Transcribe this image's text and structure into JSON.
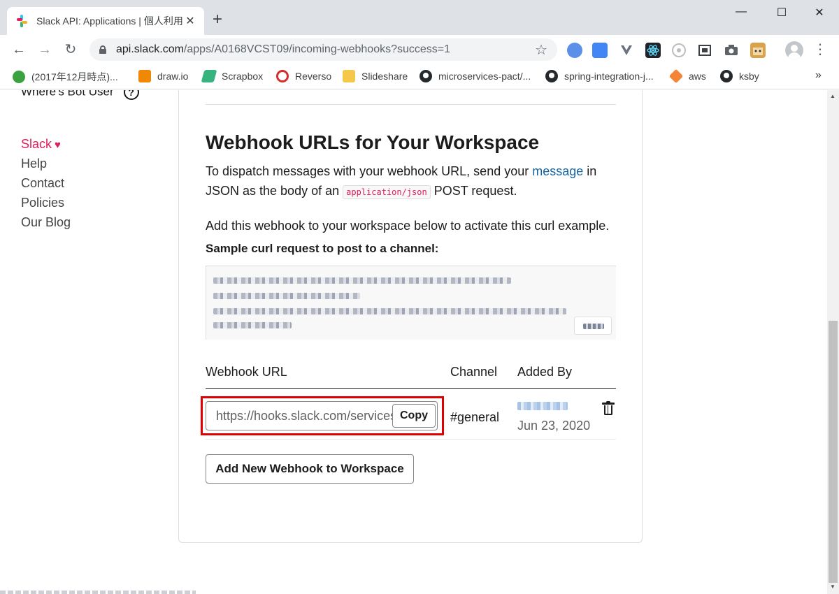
{
  "browser": {
    "tab_title": "Slack API: Applications | 個人利用",
    "tab_close": "✕",
    "new_tab": "+",
    "window_controls": {
      "minimize": "—",
      "maximize": "☐",
      "close": "✕"
    },
    "url_host": "api.slack.com",
    "url_path": "/apps/A0168VCST09/incoming-webhooks?success=1",
    "nav": {
      "back": "←",
      "forward": "→",
      "reload": "↻"
    },
    "star": "☆",
    "menu": "⋮",
    "extensions": [
      {
        "icon": "enhancer-icon",
        "color": "#5b8fe8"
      },
      {
        "icon": "google-translate-icon",
        "color": "#4285f4"
      },
      {
        "icon": "vuejs-devtools-icon",
        "color": "#6b7280"
      },
      {
        "icon": "react-devtools-icon",
        "color": "#20232a"
      },
      {
        "icon": "lighthouse-icon",
        "color": "#d6d6d6"
      },
      {
        "icon": "screen-capture-icon",
        "color": "#3c4043"
      },
      {
        "icon": "camera-icon",
        "color": "#5f6368"
      },
      {
        "icon": "tampermonkey-icon",
        "color": "#d9a34b"
      }
    ]
  },
  "bookmarks": {
    "items": [
      {
        "label": "(2017年12月時点)...",
        "icon": "green-leaf-icon",
        "color": "#3aa340"
      },
      {
        "label": "draw.io",
        "icon": "drawio-icon",
        "color": "#f08705"
      },
      {
        "label": "Scrapbox",
        "icon": "scrapbox-icon",
        "color": "#36b37e"
      },
      {
        "label": "Reverso",
        "icon": "reverso-icon",
        "color": "#1f4fa3"
      },
      {
        "label": "Slideshare",
        "icon": "folder-icon",
        "color": "#f5c84b"
      },
      {
        "label": "microservices-pact/...",
        "icon": "github-icon",
        "color": "#24292e"
      },
      {
        "label": "spring-integration-j...",
        "icon": "github-icon",
        "color": "#24292e"
      },
      {
        "label": "aws",
        "icon": "aws-cube-icon",
        "color": "#f58536"
      },
      {
        "label": "ksby",
        "icon": "github-icon",
        "color": "#24292e"
      }
    ],
    "more": "»"
  },
  "sidebar": {
    "cut_item": "Where's Bot User",
    "help_glyph": "?",
    "slack_label": "Slack",
    "heart": "♥",
    "links": [
      "Help",
      "Contact",
      "Policies",
      "Our Blog"
    ]
  },
  "main": {
    "title": "Webhook URLs for Your Workspace",
    "para1_before_link": "To dispatch messages with your webhook URL, send your ",
    "para1_link": "message",
    "para1_after_link": " in JSON as the body of an ",
    "para1_code": "application/json",
    "para1_end": " POST request.",
    "para2": "Add this webhook to your workspace below to activate this curl example.",
    "sample_label": "Sample curl request to post to a channel:",
    "table": {
      "headers": [
        "Webhook URL",
        "Channel",
        "Added By"
      ],
      "row": {
        "url": "https://hooks.slack.com/services/",
        "copy": "Copy",
        "channel": "#general",
        "added_date": "Jun 23, 2020"
      }
    },
    "add_button": "Add New Webhook to Workspace"
  },
  "colors": {
    "slack_pink": "#e01e5a",
    "link_blue": "#1264a3",
    "highlight_red": "#e00000"
  }
}
